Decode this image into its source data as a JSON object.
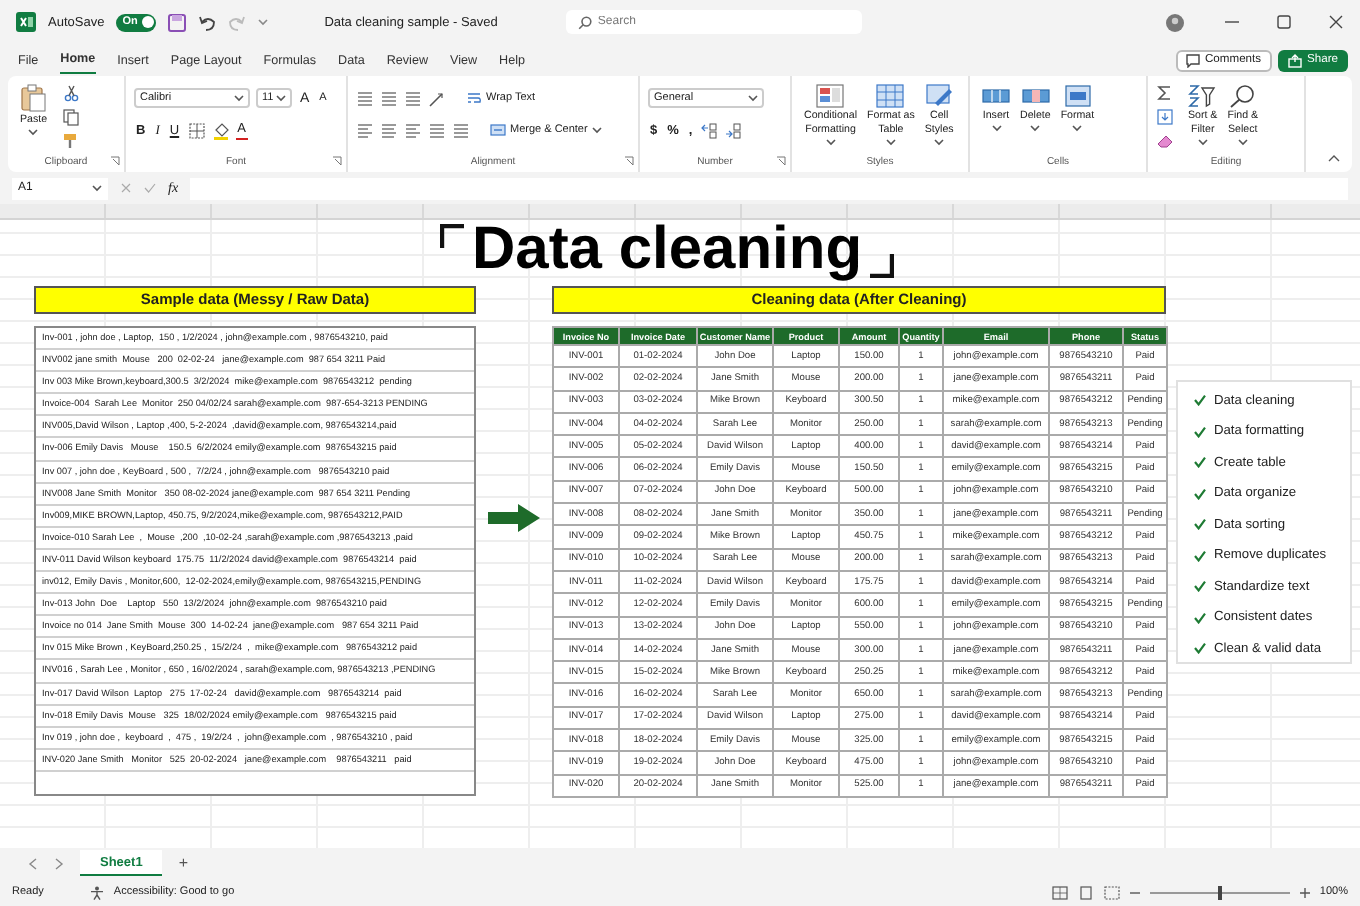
{
  "title_bar": {
    "autosave_label": "AutoSave",
    "autosave_on": true,
    "toggle_text": "On",
    "document_title": "Data cleaning sample - Saved",
    "search_placeholder": "Search"
  },
  "menu_tabs": [
    {
      "label": "File",
      "selected": false
    },
    {
      "label": "Home",
      "selected": true
    },
    {
      "label": "Insert",
      "selected": false
    },
    {
      "label": "Page Layout",
      "selected": false
    },
    {
      "label": "Formulas",
      "selected": false
    },
    {
      "label": "Data",
      "selected": false
    },
    {
      "label": "Review",
      "selected": false
    },
    {
      "label": "View",
      "selected": false
    },
    {
      "label": "Help",
      "selected": false
    }
  ],
  "actions": {
    "comments": "Comments",
    "share": "Share"
  },
  "ribbon": {
    "groups": [
      {
        "kind": "clipboard",
        "label": "Clipboard",
        "paste": "Paste"
      },
      {
        "kind": "font",
        "label": "Font",
        "font_name": "Calibri",
        "font_size": "11",
        "size_buttons": [
          "A",
          "A"
        ],
        "styles": [
          "B",
          "I",
          "U"
        ],
        "font_color": "A"
      },
      {
        "kind": "alignment",
        "label": "Alignment",
        "wrap": "Wrap Text",
        "merge": "Merge & Center"
      },
      {
        "kind": "number",
        "label": "Number",
        "format": "General",
        "symbols": [
          "$",
          "%",
          ","
        ]
      },
      {
        "kind": "buttons",
        "label": "Styles",
        "buttons": [
          {
            "lines": [
              "Conditional",
              "Formatting"
            ]
          },
          {
            "lines": [
              "Format as",
              "Table"
            ]
          },
          {
            "lines": [
              "Cell",
              "Styles"
            ]
          }
        ]
      },
      {
        "kind": "buttons",
        "label": "Cells",
        "buttons": [
          {
            "lines": [
              "Insert"
            ]
          },
          {
            "lines": [
              "Delete"
            ]
          },
          {
            "lines": [
              "Format"
            ]
          }
        ]
      },
      {
        "kind": "editing",
        "label": "Editing",
        "buttons": [
          {
            "lines": [
              "Sort &",
              "Filter"
            ]
          },
          {
            "lines": [
              "Find &",
              "Select"
            ]
          }
        ]
      }
    ]
  },
  "formula_bar": {
    "name_box": "A1",
    "fx": "fx"
  },
  "sheet": {
    "heading": "Data cleaning",
    "raw": {
      "title": "Sample data (Messy / Raw Data)",
      "rows": [
        "Inv-001 , john doe , Laptop,  150 , 1/2/2024 , john@example.com , 9876543210, paid",
        "INV002 jane smith  Mouse   200  02-02-24   jane@example.com  987 654 3211 Paid",
        "Inv 003 Mike Brown,keyboard,300.5  3/2/2024  mike@example.com  9876543212  pending",
        "Invoice-004  Sarah Lee  Monitor  250 04/02/24 sarah@example.com  987-654-3213 PENDING",
        "INV005,David Wilson , Laptop ,400, 5-2-2024  ,david@example.com, 9876543214,paid",
        "Inv-006 Emily Davis   Mouse    150.5  6/2/2024 emily@example.com  9876543215 paid",
        "Inv 007 , john doe , KeyBoard , 500 ,  7/2/24 , john@example.com   9876543210 paid",
        "INV008 Jane Smith  Monitor   350 08-02-2024 jane@example.com  987 654 3211 Pending",
        "Inv009,MIKE BROWN,Laptop, 450.75, 9/2/2024,mike@example.com, 9876543212,PAID",
        "Invoice-010 Sarah Lee  ,  Mouse  ,200  ,10-02-24 ,sarah@example.com ,9876543213 ,paid",
        "INV-011 David Wilson keyboard  175.75  11/2/2024 david@example.com  9876543214  paid",
        "inv012, Emily Davis , Monitor,600,  12-02-2024,emily@example.com, 9876543215,PENDING",
        "Inv-013 John  Doe    Laptop   550  13/2/2024  john@example.com  9876543210 paid",
        "Invoice no 014  Jane Smith  Mouse  300  14-02-24  jane@example.com   987 654 3211 Paid",
        "Inv 015 Mike Brown , KeyBoard,250.25 ,  15/2/24  ,  mike@example.com   9876543212 paid",
        "INV016 , Sarah Lee , Monitor , 650 , 16/02/2024 , sarah@example.com, 9876543213 ,PENDING",
        "Inv-017 David Wilson  Laptop   275  17-02-24   david@example.com   9876543214  paid",
        "Inv-018 Emily Davis  Mouse   325  18/02/2024 emily@example.com   9876543215 paid",
        "Inv 019 , john doe ,  keyboard  ,  475 ,  19/2/24  ,  john@example.com  , 9876543210 , paid",
        "INV-020 Jane Smith   Monitor   525  20-02-2024   jane@example.com    9876543211   paid"
      ]
    },
    "clean": {
      "title": "Cleaning data (After Cleaning)",
      "columns": [
        "Invoice No",
        "Invoice Date",
        "Customer Name",
        "Product",
        "Amount",
        "Quantity",
        "Email",
        "Phone",
        "Status"
      ],
      "rows": [
        [
          "INV-001",
          "01-02-2024",
          "John Doe",
          "Laptop",
          "150.00",
          "1",
          "john@example.com",
          "9876543210",
          "Paid"
        ],
        [
          "INV-002",
          "02-02-2024",
          "Jane Smith",
          "Mouse",
          "200.00",
          "1",
          "jane@example.com",
          "9876543211",
          "Paid"
        ],
        [
          "INV-003",
          "03-02-2024",
          "Mike Brown",
          "Keyboard",
          "300.50",
          "1",
          "mike@example.com",
          "9876543212",
          "Pending"
        ],
        [
          "INV-004",
          "04-02-2024",
          "Sarah Lee",
          "Monitor",
          "250.00",
          "1",
          "sarah@example.com",
          "9876543213",
          "Pending"
        ],
        [
          "INV-005",
          "05-02-2024",
          "David Wilson",
          "Laptop",
          "400.00",
          "1",
          "david@example.com",
          "9876543214",
          "Paid"
        ],
        [
          "INV-006",
          "06-02-2024",
          "Emily Davis",
          "Mouse",
          "150.50",
          "1",
          "emily@example.com",
          "9876543215",
          "Paid"
        ],
        [
          "INV-007",
          "07-02-2024",
          "John Doe",
          "Keyboard",
          "500.00",
          "1",
          "john@example.com",
          "9876543210",
          "Paid"
        ],
        [
          "INV-008",
          "08-02-2024",
          "Jane Smith",
          "Monitor",
          "350.00",
          "1",
          "jane@example.com",
          "9876543211",
          "Pending"
        ],
        [
          "INV-009",
          "09-02-2024",
          "Mike Brown",
          "Laptop",
          "450.75",
          "1",
          "mike@example.com",
          "9876543212",
          "Paid"
        ],
        [
          "INV-010",
          "10-02-2024",
          "Sarah Lee",
          "Mouse",
          "200.00",
          "1",
          "sarah@example.com",
          "9876543213",
          "Paid"
        ],
        [
          "INV-011",
          "11-02-2024",
          "David Wilson",
          "Keyboard",
          "175.75",
          "1",
          "david@example.com",
          "9876543214",
          "Paid"
        ],
        [
          "INV-012",
          "12-02-2024",
          "Emily Davis",
          "Monitor",
          "600.00",
          "1",
          "emily@example.com",
          "9876543215",
          "Pending"
        ],
        [
          "INV-013",
          "13-02-2024",
          "John Doe",
          "Laptop",
          "550.00",
          "1",
          "john@example.com",
          "9876543210",
          "Paid"
        ],
        [
          "INV-014",
          "14-02-2024",
          "Jane Smith",
          "Mouse",
          "300.00",
          "1",
          "jane@example.com",
          "9876543211",
          "Paid"
        ],
        [
          "INV-015",
          "15-02-2024",
          "Mike Brown",
          "Keyboard",
          "250.25",
          "1",
          "mike@example.com",
          "9876543212",
          "Paid"
        ],
        [
          "INV-016",
          "16-02-2024",
          "Sarah Lee",
          "Monitor",
          "650.00",
          "1",
          "sarah@example.com",
          "9876543213",
          "Pending"
        ],
        [
          "INV-017",
          "17-02-2024",
          "David Wilson",
          "Laptop",
          "275.00",
          "1",
          "david@example.com",
          "9876543214",
          "Paid"
        ],
        [
          "INV-018",
          "18-02-2024",
          "Emily Davis",
          "Mouse",
          "325.00",
          "1",
          "emily@example.com",
          "9876543215",
          "Paid"
        ],
        [
          "INV-019",
          "19-02-2024",
          "John Doe",
          "Keyboard",
          "475.00",
          "1",
          "john@example.com",
          "9876543210",
          "Paid"
        ],
        [
          "INV-020",
          "20-02-2024",
          "Jane Smith",
          "Monitor",
          "525.00",
          "1",
          "jane@example.com",
          "9876543211",
          "Paid"
        ]
      ]
    },
    "checklist": [
      "Data cleaning",
      "Data formatting",
      "Create table",
      "Data organize",
      "Data sorting",
      "Remove duplicates",
      "Standardize text",
      "Consistent dates",
      "Clean & valid data"
    ]
  },
  "sheet_tabs": [
    {
      "label": "Sheet1",
      "selected": true
    }
  ],
  "add_sheet": "+",
  "status_bar": {
    "ready": "Ready",
    "accessibility": "Accessibility: Good to go",
    "zoom": {
      "level": 0.5,
      "reading": "100%"
    }
  }
}
